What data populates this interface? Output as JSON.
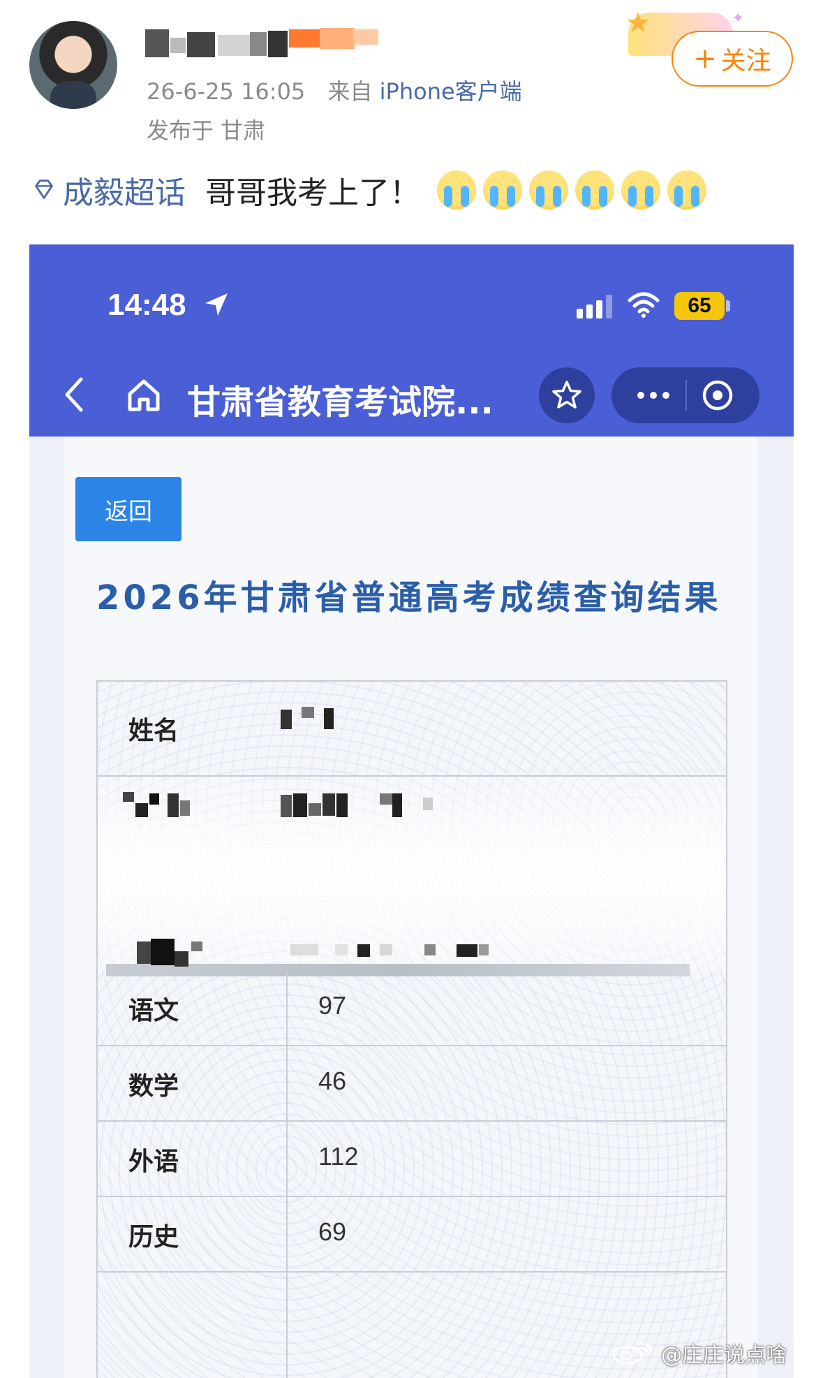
{
  "post": {
    "timestamp": "26-6-25 16:05",
    "source_prefix": "来自",
    "source_app": "iPhone客户端",
    "location": "发布于 甘肃",
    "follow_label": "关注",
    "follow_plus": "+",
    "topic": "成毅超话",
    "text": "哥哥我考上了！",
    "emoji_name": "crying-face-icon",
    "emoji_count": 6
  },
  "colors": {
    "follow": "#ff8200",
    "topic": "#4a6aa6",
    "header_bg": "#4a5ed6",
    "return_btn": "#2b84e6",
    "title": "#2a5ea8"
  },
  "screenshot": {
    "status_time": "14:48",
    "battery": "65",
    "nav_title": "甘肃省教育考试院...",
    "return_label": "返回",
    "result_title": "2026年甘肃省普通高考成绩查询结果",
    "table": {
      "name_label": "姓名",
      "rows": [
        {
          "subject": "语文",
          "score": "97"
        },
        {
          "subject": "数学",
          "score": "46"
        },
        {
          "subject": "外语",
          "score": "112"
        },
        {
          "subject": "历史",
          "score": "69"
        }
      ]
    }
  },
  "watermark": "@庄庄说点啥"
}
